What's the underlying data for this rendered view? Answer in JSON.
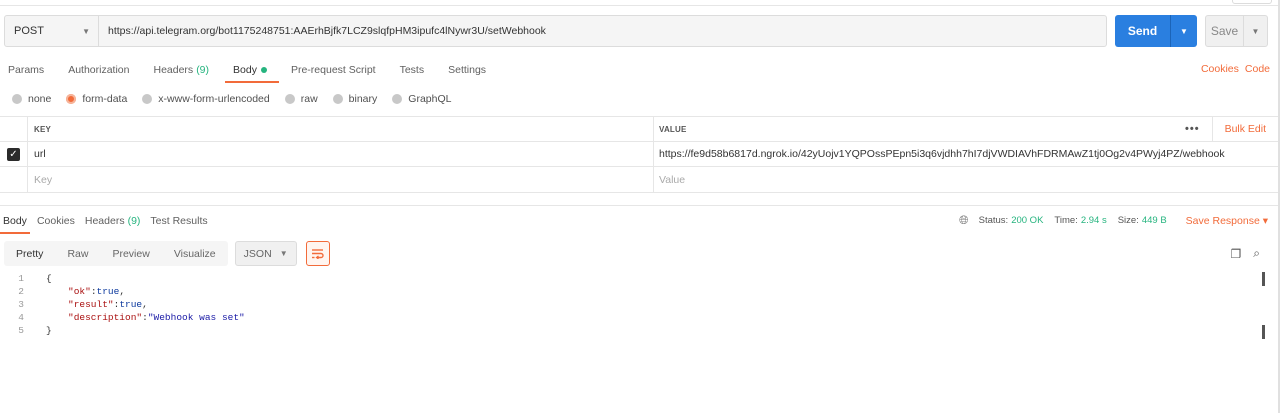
{
  "request": {
    "method": "POST",
    "url": "https://api.telegram.org/bot1175248751:AAErhBjfk7LCZ9slqfpHM3ipufc4lNywr3U/setWebhook",
    "send_label": "Send",
    "save_label": "Save"
  },
  "request_tabs": {
    "params": "Params",
    "authorization": "Authorization",
    "headers": "Headers",
    "headers_count": "(9)",
    "body": "Body",
    "prerequest": "Pre-request Script",
    "tests": "Tests",
    "settings": "Settings",
    "cookies": "Cookies",
    "code": "Code"
  },
  "body_types": {
    "none": "none",
    "form_data": "form-data",
    "urlencoded": "x-www-form-urlencoded",
    "raw": "raw",
    "binary": "binary",
    "graphql": "GraphQL",
    "selected": "form-data"
  },
  "kv_table": {
    "key_header": "KEY",
    "value_header": "VALUE",
    "bulk_edit": "Bulk Edit",
    "more": "•••",
    "rows": [
      {
        "key": "url",
        "value": "https://fe9d58b6817d.ngrok.io/42yUojv1YQPOssPEpn5i3q6vjdhh7hI7djVWDIAVhFDRMAwZ1tj0Og2v4PWyj4PZ/webhook",
        "checked": true
      }
    ],
    "key_placeholder": "Key",
    "value_placeholder": "Value"
  },
  "response_tabs": {
    "body": "Body",
    "cookies": "Cookies",
    "headers": "Headers",
    "headers_count": "(9)",
    "test_results": "Test Results"
  },
  "response_meta": {
    "status_label": "Status:",
    "status_value": "200 OK",
    "time_label": "Time:",
    "time_value": "2.94 s",
    "size_label": "Size:",
    "size_value": "449 B",
    "save_response": "Save Response"
  },
  "response_view": {
    "pretty": "Pretty",
    "raw": "Raw",
    "preview": "Preview",
    "visualize": "Visualize",
    "format": "JSON"
  },
  "response_body": {
    "lines": [
      "1",
      "2",
      "3",
      "4",
      "5"
    ],
    "open_brace": "{",
    "close_brace": "}",
    "ok_key": "\"ok\"",
    "ok_value": "true",
    "result_key": "\"result\"",
    "result_value": "true",
    "description_key": "\"description\"",
    "description_value": "\"Webhook was set\""
  },
  "colors": {
    "accent": "#f26b3a",
    "send": "#2a7fe0",
    "success": "#26b47f"
  }
}
